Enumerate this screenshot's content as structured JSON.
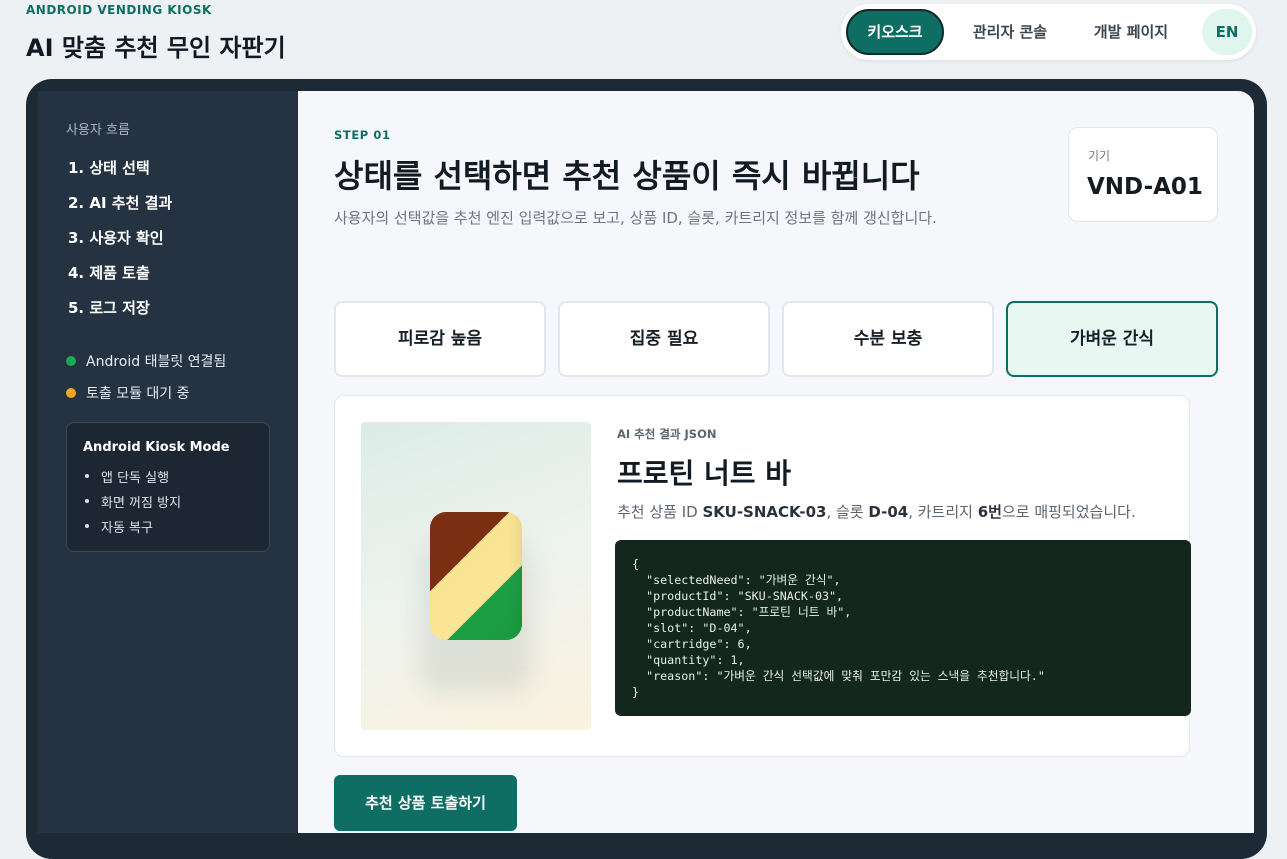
{
  "header": {
    "kicker": "ANDROID VENDING KIOSK",
    "title": "AI 맞춤 추천 무인 자판기",
    "nav": {
      "kiosk": "키오스크",
      "admin": "관리자 콘솔",
      "dev": "개발 페이지",
      "lang": "EN"
    }
  },
  "sidebar": {
    "heading": "사용자 흐름",
    "steps": [
      "1. 상태 선택",
      "2. AI 추천 결과",
      "3. 사용자 확인",
      "4. 제품 토출",
      "5. 로그 저장"
    ],
    "statuses": [
      {
        "label": "Android 태블릿 연결됨",
        "color": "#18a957"
      },
      {
        "label": "토출 모듈 대기 중",
        "color": "#f0a623"
      }
    ],
    "mode": {
      "title": "Android Kiosk Mode",
      "items": [
        "앱 단독 실행",
        "화면 꺼짐 방지",
        "자동 복구"
      ]
    }
  },
  "main": {
    "step_kicker": "STEP 01",
    "title": "상태를 선택하면 추천 상품이 즉시 바뀝니다",
    "description": "사용자의 선택값을 추천 엔진 입력값으로 보고, 상품 ID, 슬롯, 카트리지 정보를 함께 갱신합니다.",
    "device": {
      "label": "기기",
      "id": "VND-A01"
    },
    "needs": [
      {
        "label": "피로감 높음",
        "selected": false
      },
      {
        "label": "집중 필요",
        "selected": false
      },
      {
        "label": "수분 보충",
        "selected": false
      },
      {
        "label": "가벼운 간식",
        "selected": true
      }
    ],
    "result": {
      "kicker": "AI 추천 결과 JSON",
      "product_name": "프로틴 너트 바",
      "mapping": {
        "prefix": "추천 상품 ID ",
        "product_id": "SKU-SNACK-03",
        "slot_text": ", 슬롯 ",
        "slot": "D-04",
        "cartridge_text": ", 카트리지 ",
        "cartridge": "6번",
        "suffix": "으로 매핑되었습니다."
      },
      "json": "{\n  \"selectedNeed\": \"가벼운 간식\",\n  \"productId\": \"SKU-SNACK-03\",\n  \"productName\": \"프로틴 너트 바\",\n  \"slot\": \"D-04\",\n  \"cartridge\": 6,\n  \"quantity\": 1,\n  \"reason\": \"가벼운 간식 선택값에 맞춰 포만감 있는 스낵을 추천합니다.\"\n}"
    },
    "cta": "추천 상품 토출하기"
  },
  "colors": {
    "accent": "#0f6e63",
    "sidebar_bg": "#243241",
    "frame_bg": "#1d2a35",
    "json_bg": "#14271f"
  }
}
